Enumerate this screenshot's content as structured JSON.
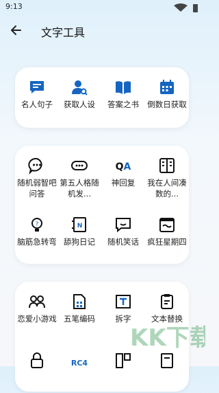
{
  "status": {
    "time": "9:13"
  },
  "appbar": {
    "title": "文字工具"
  },
  "accent": "#1565c0",
  "card1": {
    "items": [
      {
        "label": "名人句子",
        "icon": "chat-quote-icon"
      },
      {
        "label": "获取人设",
        "icon": "user-search-icon"
      },
      {
        "label": "答案之书",
        "icon": "open-book-icon"
      },
      {
        "label": "倒数日获取",
        "icon": "calendar-icon"
      }
    ]
  },
  "card2": {
    "items": [
      {
        "label": "随机弱智吧问答",
        "icon": "chat-dots-icon"
      },
      {
        "label": "第五人格随机发...",
        "icon": "gamepad-icon"
      },
      {
        "label": "神回复",
        "icon": "qa-text-icon"
      },
      {
        "label": "我在人间凑数的...",
        "icon": "book-grid-icon"
      },
      {
        "label": "脑筋急转弯",
        "icon": "lightbulb-question-icon"
      },
      {
        "label": "舔狗日记",
        "icon": "notebook-icon"
      },
      {
        "label": "随机笑话",
        "icon": "chat-smile-icon"
      },
      {
        "label": "疯狂星期四",
        "icon": "calendar-wave-icon"
      }
    ]
  },
  "card3": {
    "items": [
      {
        "label": "恋爱小游戏",
        "icon": "couple-icon"
      },
      {
        "label": "五笔编码",
        "icon": "document-grid-icon"
      },
      {
        "label": "拆字",
        "icon": "text-frame-icon"
      },
      {
        "label": "文本替换",
        "icon": "clipboard-edit-icon"
      },
      {
        "label": "",
        "icon": "lock-icon"
      },
      {
        "label": "RC4",
        "icon": "rc4-text-icon"
      },
      {
        "label": "",
        "icon": "layout-icon"
      },
      {
        "label": "",
        "icon": "document-icon"
      }
    ]
  },
  "watermark": {
    "text": "KK下载"
  }
}
